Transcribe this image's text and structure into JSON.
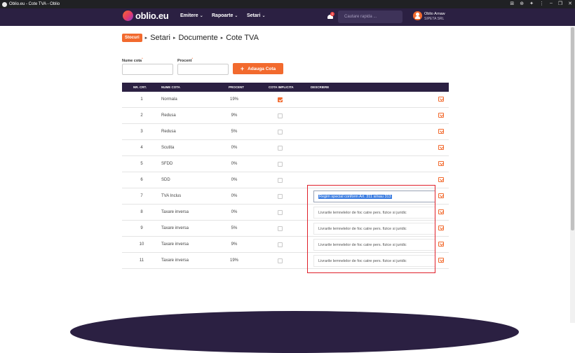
{
  "browser": {
    "tab_title": "Oblio.eu - Cote TVA - Oblio"
  },
  "navbar": {
    "logo_text": "oblio.eu",
    "menu": [
      {
        "label": "Emitere"
      },
      {
        "label": "Rapoarte"
      },
      {
        "label": "Setari"
      }
    ],
    "notification_count": "1",
    "search_placeholder": "Cautare rapida ...",
    "user_name": "Oblio Arnaw",
    "user_company": "SIPETA SRL",
    "brand_color": "#2b2042",
    "accent_color": "#f26a2e"
  },
  "breadcrumb": {
    "badge": "Stocuri",
    "items": [
      "Setari",
      "Documente",
      "Cote TVA"
    ]
  },
  "form": {
    "name_label": "Nume cota",
    "percent_label": "Procent",
    "required_mark": "*",
    "add_button": "Adauga Cota"
  },
  "table": {
    "headers": [
      "NR. CRT.",
      "NUME COTA",
      "PROCENT",
      "COTA IMPLICITA",
      "DESCRIERE"
    ],
    "rows": [
      {
        "nr": "1",
        "name": "Normala",
        "percent": "19%",
        "default": true,
        "description": ""
      },
      {
        "nr": "2",
        "name": "Redusa",
        "percent": "9%",
        "default": false,
        "description": ""
      },
      {
        "nr": "3",
        "name": "Redusa",
        "percent": "5%",
        "default": false,
        "description": ""
      },
      {
        "nr": "4",
        "name": "Scutita",
        "percent": "0%",
        "default": false,
        "description": ""
      },
      {
        "nr": "5",
        "name": "SFDD",
        "percent": "0%",
        "default": false,
        "description": ""
      },
      {
        "nr": "6",
        "name": "SDD",
        "percent": "0%",
        "default": false,
        "description": ""
      },
      {
        "nr": "7",
        "name": "TVA Inclus",
        "percent": "0%",
        "default": false,
        "description": "Regim special conform Art. 311 si/sau 313"
      },
      {
        "nr": "8",
        "name": "Taxare inversa",
        "percent": "0%",
        "default": false,
        "description": "Livrarile lemnelelor de foc catre pers. fizice si juridic"
      },
      {
        "nr": "9",
        "name": "Taxare inversa",
        "percent": "5%",
        "default": false,
        "description": "Livrarile lemnelelor de foc catre pers. fizice si juridic"
      },
      {
        "nr": "10",
        "name": "Taxare inversa",
        "percent": "9%",
        "default": false,
        "description": "Livrarile lemnelelor de foc catre pers. fizice si juridic"
      },
      {
        "nr": "11",
        "name": "Taxare inversa",
        "percent": "19%",
        "default": false,
        "description": "Livrarile lemnelelor de foc catre pers. fizice si juridic"
      }
    ]
  }
}
